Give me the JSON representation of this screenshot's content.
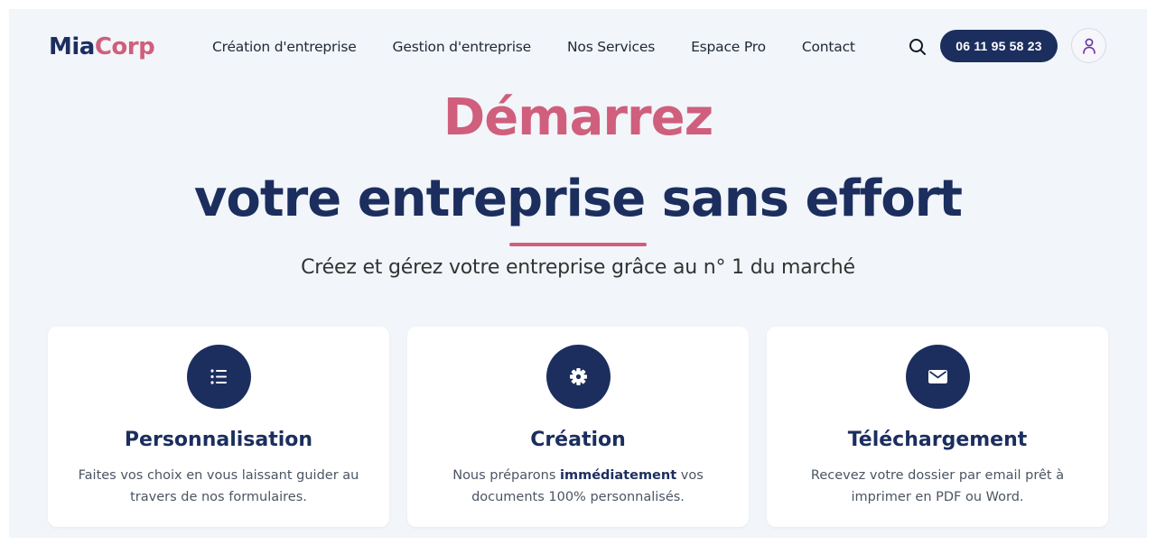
{
  "brand": {
    "part1": "Mia",
    "part2": "Corp"
  },
  "nav": {
    "items": [
      {
        "label": "Création d'entreprise"
      },
      {
        "label": "Gestion d'entreprise"
      },
      {
        "label": "Nos Services"
      },
      {
        "label": "Espace Pro"
      },
      {
        "label": "Contact"
      }
    ]
  },
  "header": {
    "search_icon": "search-icon",
    "phone": "06 11 95 58 23",
    "user_icon": "user-icon"
  },
  "hero": {
    "line1": "Démarrez",
    "line2": "votre entreprise sans effort",
    "subtitle": "Créez et gérez votre entreprise grâce au n° 1 du marché"
  },
  "features": [
    {
      "icon": "list-icon",
      "title": "Personnalisation",
      "text": "Faites vos choix en vous laissant guider au travers de nos formulaires."
    },
    {
      "icon": "gear-icon",
      "title": "Création",
      "text_before": "Nous préparons ",
      "text_bold": "immédiatement",
      "text_after": " vos documents 100% personnalisés."
    },
    {
      "icon": "envelope-icon",
      "title": "Téléchargement",
      "text": "Recevez votre dossier par email prêt à imprimer en PDF ou Word."
    }
  ],
  "colors": {
    "navy": "#1b2e5e",
    "pink": "#cf5f7c",
    "background": "#f2f5f9"
  }
}
